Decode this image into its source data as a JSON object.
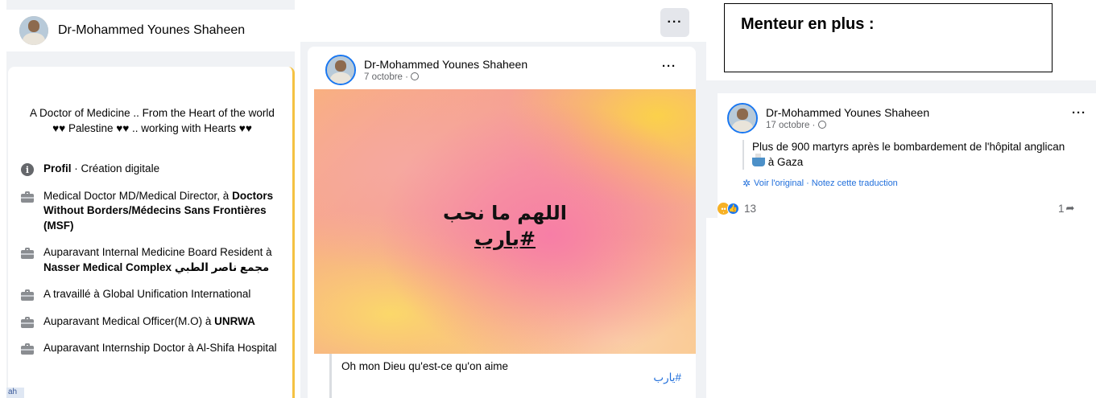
{
  "profile": {
    "name": "Dr-Mohammed Younes Shaheen"
  },
  "intro": {
    "bio": "A Doctor of Medicine .. From the Heart of the world ♥♥ Palestine ♥♥ .. working with Hearts ♥♥",
    "items": [
      {
        "icon": "info-icon",
        "prefix": "",
        "bold": "Profil",
        "suffix": " · Création digitale"
      },
      {
        "icon": "briefcase-icon",
        "prefix": "Medical Doctor MD/Medical Director, à ",
        "bold": "Doctors Without Borders/Médecins Sans Frontières (MSF)",
        "suffix": ""
      },
      {
        "icon": "briefcase-icon",
        "prefix": "Auparavant Internal Medicine Board Resident à ",
        "bold": "Nasser Medical Complex مجمع ناصر الطبي",
        "suffix": ""
      },
      {
        "icon": "briefcase-icon",
        "prefix": "A travaillé à Global Unification International",
        "bold": "",
        "suffix": ""
      },
      {
        "icon": "briefcase-icon",
        "prefix": "Auparavant Medical Officer(M.O) à ",
        "bold": "UNRWA",
        "suffix": ""
      },
      {
        "icon": "briefcase-icon",
        "prefix": "Auparavant Internship Doctor à Al-Shifa Hospital",
        "bold": "",
        "suffix": ""
      }
    ],
    "corner_tag": "ah"
  },
  "post1": {
    "author": "Dr-Mohammed Younes Shaheen",
    "date": "7 octobre ·",
    "more_label": "···",
    "arabic_line1": "اللهم ما نحب",
    "arabic_line2": "#يارب",
    "translation": "Oh mon Dieu qu'est-ce qu'on aime",
    "hashtag": "#يارب"
  },
  "top_more_label": "···",
  "note": {
    "text": "Menteur en plus :"
  },
  "post2": {
    "author": "Dr-Mohammed Younes Shaheen",
    "date": "17 octobre ·",
    "more_label": "···",
    "body_line1": "Plus de 900 martyrs après le bombardement de l'hôpital anglican",
    "body_line2": " à Gaza",
    "see_original": "Voir l'original · Notez cette traduction",
    "reaction_count": "13",
    "share_count": "1"
  }
}
